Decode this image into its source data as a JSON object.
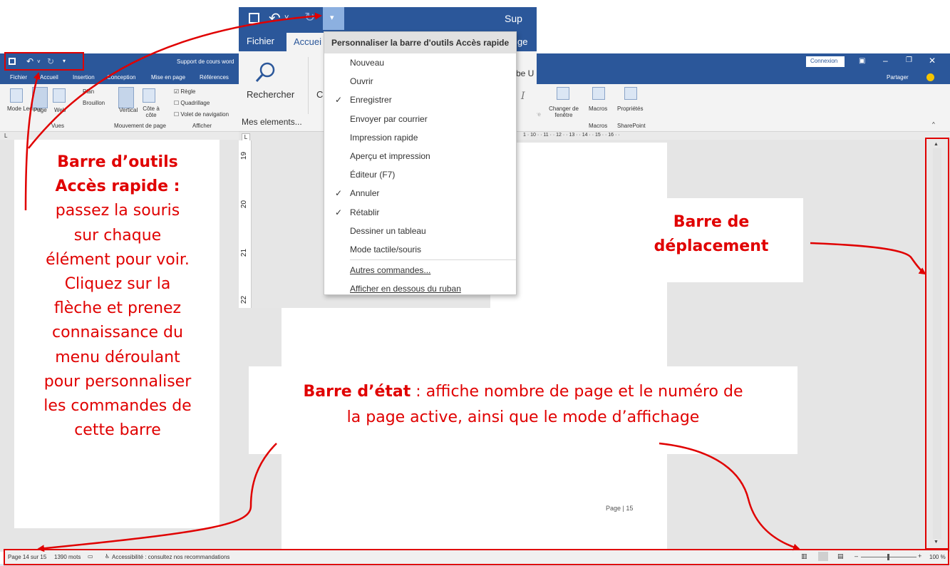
{
  "background_window": {
    "title": "Support de cours word",
    "tabs": [
      "Fichier",
      "Accueil",
      "Insertion",
      "Conception",
      "Mise en page",
      "Références"
    ],
    "connexion_button": "Connexion",
    "share_label": "Partager",
    "tell_me": "be U",
    "ribbon": {
      "vues": {
        "group_label": "Vues",
        "buttons": [
          "Mode Lecture",
          "Page",
          "Web"
        ],
        "side": [
          "Plan",
          "Brouillon"
        ]
      },
      "mouvement": {
        "group_label": "Mouvement de page",
        "buttons": [
          "Vertical",
          "Côte à côte"
        ]
      },
      "afficher": {
        "group_label": "Afficher",
        "checks": [
          "Règle",
          "Quadrillage",
          "Volet de navigation"
        ]
      },
      "fenetre_partial": "être",
      "changer_fenetre": "Changer de fenêtre",
      "macros": {
        "group_label": "Macros",
        "button": "Macros"
      },
      "sharepoint": {
        "group_label": "SharePoint",
        "button": "Propriétés"
      }
    },
    "ruler_text": "1 · 10 · · 11 · · 12 · · 13 · · 14 · · 15 · · 16 · ·",
    "page_footer": "Page | 15"
  },
  "foreground_window": {
    "title_partial": "Sup",
    "tabs": [
      "Fichier",
      "Accuei",
      "ge"
    ],
    "search_button": "Rechercher",
    "partial_letter": "C",
    "group_label": "Mes elements...",
    "ruler_numbers": [
      "19",
      "20",
      "21",
      "22"
    ]
  },
  "dropdown_menu": {
    "title": "Personnaliser la barre d'outils Accès rapide",
    "items": [
      {
        "label": "Nouveau",
        "checked": false
      },
      {
        "label": "Ouvrir",
        "checked": false
      },
      {
        "label": "Enregistrer",
        "checked": true
      },
      {
        "label": "Envoyer par courrier",
        "checked": false
      },
      {
        "label": "Impression rapide",
        "checked": false
      },
      {
        "label": "Aperçu et impression",
        "checked": false
      },
      {
        "label": "Éditeur (F7)",
        "checked": false
      },
      {
        "label": "Annuler",
        "checked": true
      },
      {
        "label": "Rétablir",
        "checked": true
      },
      {
        "label": "Dessiner un tableau",
        "checked": false
      },
      {
        "label": "Mode tactile/souris",
        "checked": false
      }
    ],
    "footer_items": [
      "Autres commandes...",
      "Afficher en dessous du ruban"
    ],
    "check_glyph": "✓"
  },
  "annotations": {
    "left_bold_1": "Barre d’outils",
    "left_bold_2": "Accès rapide :",
    "left_lines": [
      "passez la souris",
      "sur chaque",
      "élément pour voir.",
      "Cliquez sur la",
      "flèche et prenez",
      "connaissance du",
      "menu déroulant",
      "pour personnaliser",
      "les commandes de",
      "cette barre"
    ],
    "right_bold_1": "Barre de",
    "right_bold_2": "déplacement",
    "bottom_bold": "Barre d’état",
    "bottom_line_1": " : affiche nombre de page et le numéro de",
    "bottom_line_2": "la page active, ainsi que le mode d’affichage"
  },
  "statusbar": {
    "page": "Page 14 sur 15",
    "words": "1390 mots",
    "accessibility": "Accessibilité : consultez nos recommandations",
    "zoom": "100 %"
  },
  "colors": {
    "word_blue": "#2b579a",
    "annotation_red": "#e00000"
  },
  "icons": [
    "save-icon",
    "undo-icon",
    "redo-icon",
    "customize-arrow-icon",
    "search-icon",
    "smiley-icon"
  ]
}
